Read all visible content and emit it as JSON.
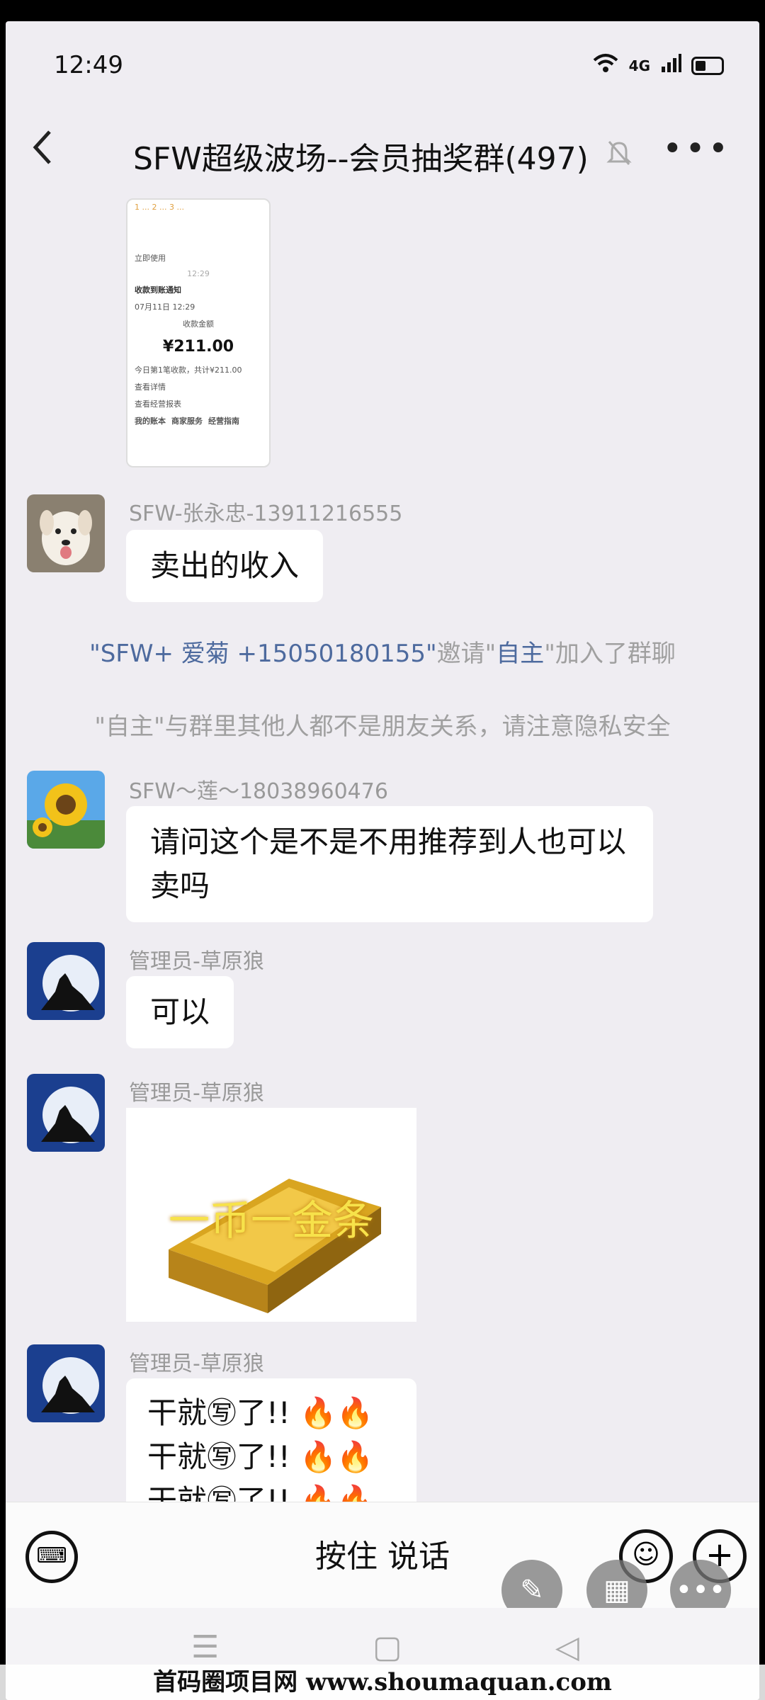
{
  "status": {
    "time": "12:49",
    "network": "4G"
  },
  "header": {
    "title": "SFW超级波场--会员抽奖群(497)"
  },
  "screenshot_card": {
    "notice": "收款到账通知",
    "date": "07月11日 12:29",
    "amount_label": "收款金额",
    "amount": "¥211.00",
    "summary": "今日第1笔收款，共计¥211.00",
    "link1": "查看详情",
    "link2": "查看经营报表",
    "footer1": "我的账本",
    "footer2": "商家服务",
    "footer3": "经营指南",
    "immediate": "立即使用"
  },
  "messages": [
    {
      "sender": "SFW-张永忠-13911216555",
      "text": "卖出的收入"
    },
    {
      "sender": "SFW～莲～18038960476",
      "text": "请问这个是不是不用推荐到人也可以卖吗"
    },
    {
      "sender": "管理员-草原狼",
      "text": "可以"
    },
    {
      "sender": "管理员-草原狼",
      "image_caption": "一币一金条"
    },
    {
      "sender": "管理员-草原狼",
      "lines": [
        "干就㊢了!! 🔥🔥",
        "干就㊢了!! 🔥🔥",
        "干就㊢了!! 🔥🔥"
      ]
    }
  ],
  "system": {
    "invite_inviter": "\"SFW+ 爱菊 +15050180155\"",
    "invite_mid": "邀请\"",
    "invite_invitee": "自主",
    "invite_end": "\"加入了群聊",
    "privacy": "\"自主\"与群里其他人都不是朋友关系，请注意隐私安全"
  },
  "input": {
    "voice_label": "按住 说话"
  },
  "watermark": "首码圈项目网 www.shoumaquan.com",
  "colors": {
    "background": "#efedf2",
    "link": "#4d6a9e"
  }
}
